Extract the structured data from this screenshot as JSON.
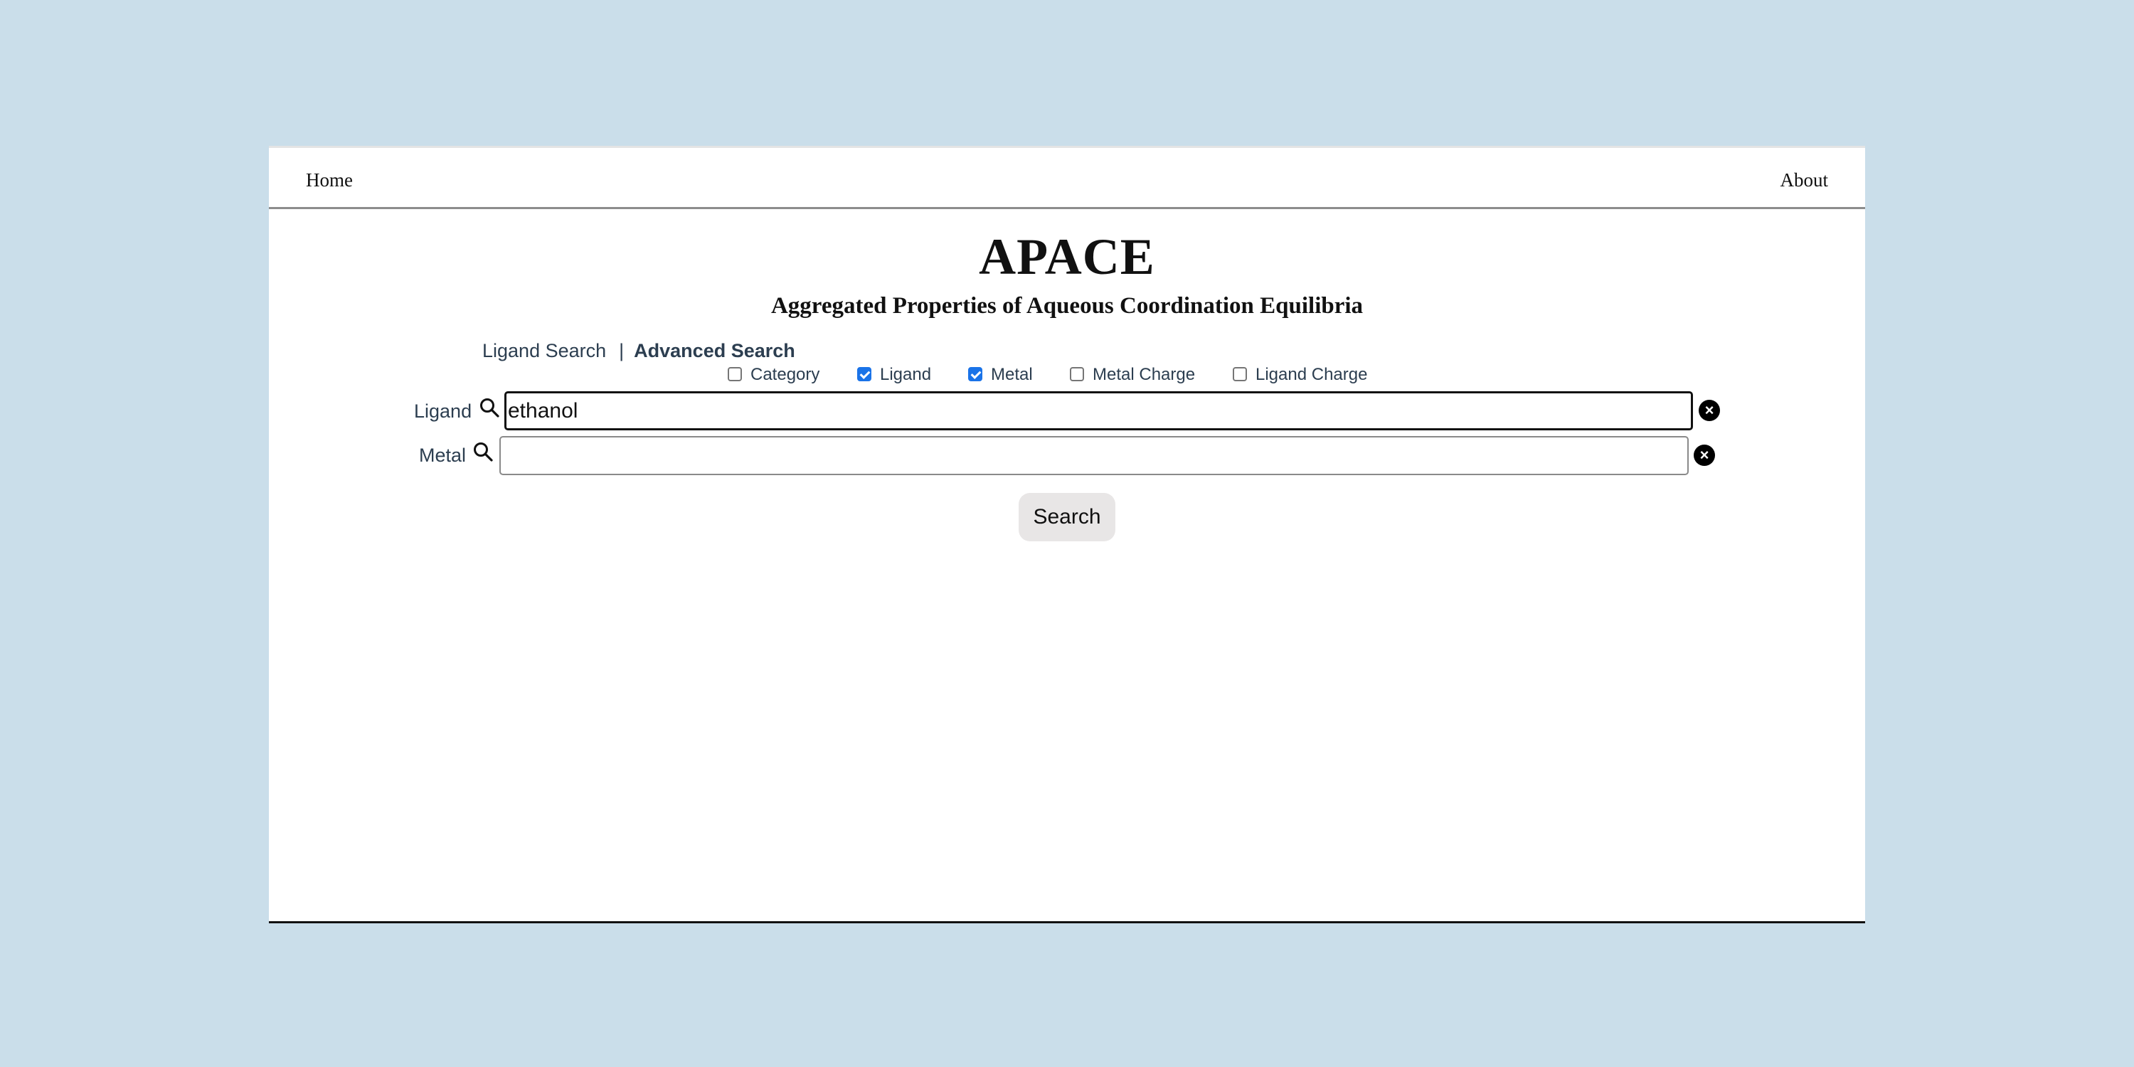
{
  "nav": {
    "home": "Home",
    "about": "About"
  },
  "header": {
    "title": "APACE",
    "subtitle": "Aggregated Properties of Aqueous Coordination Equilibria"
  },
  "search_tabs": {
    "ligand_search": "Ligand Search",
    "separator": "|",
    "advanced_search": "Advanced Search",
    "active": "Advanced Search"
  },
  "filters": [
    {
      "label": "Category",
      "checked": false
    },
    {
      "label": "Ligand",
      "checked": true
    },
    {
      "label": "Metal",
      "checked": true
    },
    {
      "label": "Metal Charge",
      "checked": false
    },
    {
      "label": "Ligand Charge",
      "checked": false
    }
  ],
  "fields": {
    "ligand": {
      "label": "Ligand",
      "value": "ethanol",
      "focused": true
    },
    "metal": {
      "label": "Metal",
      "value": "",
      "focused": false
    }
  },
  "actions": {
    "search_label": "Search"
  },
  "icons": {
    "search": "search-icon",
    "clear": "clear-icon",
    "checkbox_checked_color": "#1a73e8"
  },
  "colors": {
    "background": "#cadeea",
    "page": "#ffffff",
    "text_accent": "#2c3e50",
    "button_bg": "#e8e6e6"
  }
}
